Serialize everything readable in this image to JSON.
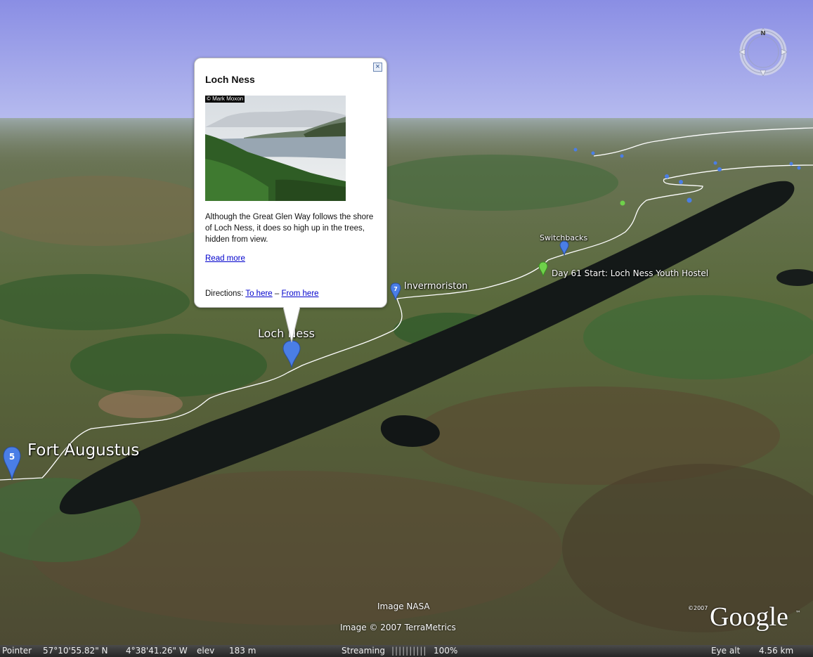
{
  "balloon": {
    "title": "Loch Ness",
    "photo_credit": "© Mark Moxon",
    "description": "Although the Great Glen Way follows the shore of Loch Ness, it does so high up in the trees, hidden from view.",
    "read_more": "Read more",
    "directions_label": "Directions:",
    "to_here": "To here",
    "separator": "–",
    "from_here": "From here",
    "close_glyph": "×"
  },
  "map_labels": {
    "fort_augustus": "Fort Augustus",
    "loch_ness": "Loch Ness",
    "invermoriston": "Invermoriston",
    "switchbacks": "Switchbacks",
    "day61": "Day 61 Start: Loch Ness Youth Hostel"
  },
  "pins": {
    "fort_augustus_number": "5",
    "invermoriston_number": "7"
  },
  "compass": {
    "north": "N"
  },
  "credits": {
    "image_nasa": "Image NASA",
    "terrametrics": "Image © 2007 TerraMetrics",
    "google_year": "©2007",
    "google_logo": "Google",
    "google_tm": "™"
  },
  "status": {
    "pointer_label": "Pointer",
    "lat": "57°10'55.82\" N",
    "lon": "4°38'41.26\" W",
    "elev_label": "elev",
    "elev_value": "183 m",
    "streaming_label": "Streaming",
    "streaming_bar": "||||||||||",
    "streaming_pct": "100%",
    "eye_alt_label": "Eye alt",
    "eye_alt_value": "4.56 km"
  },
  "colors": {
    "sky_top": "#8a8ee4",
    "sky_bottom": "#b6bdee",
    "terrain": "#5b6140",
    "loch": "#151a1a",
    "trail": "#ffffff",
    "pin_blue": "#4a7ee6",
    "pin_green": "#6fd14a",
    "link": "#0000cc"
  }
}
